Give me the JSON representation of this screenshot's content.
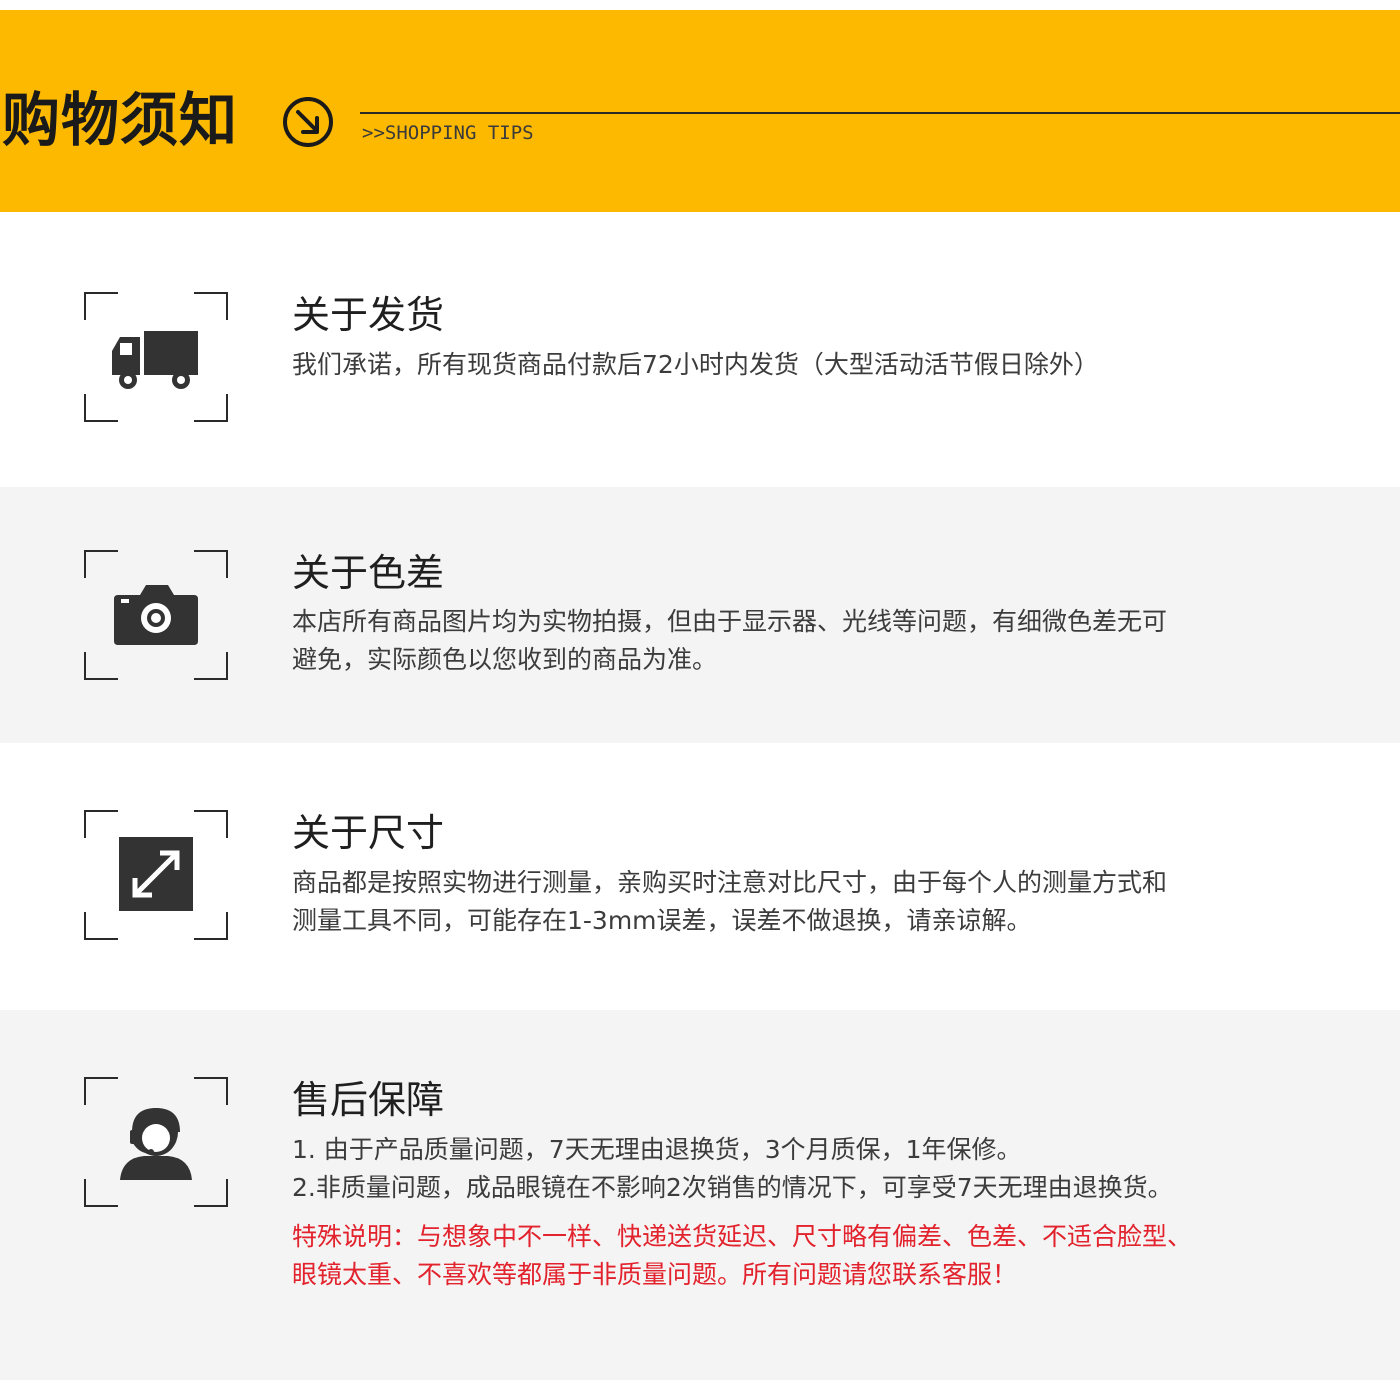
{
  "header": {
    "title": "购物须知",
    "subtitle": ">>SHOPPING TIPS",
    "background_color": "#fdb900",
    "arrow_icon": "circle-arrow-down-right-icon"
  },
  "sections": [
    {
      "icon": "truck-icon",
      "title": "关于发货",
      "lines": [
        "我们承诺，所有现货商品付款后72小时内发货（大型活动活节假日除外）"
      ]
    },
    {
      "icon": "camera-icon",
      "title": "关于色差",
      "lines": [
        "本店所有商品图片均为实物拍摄，但由于显示器、光线等问题，有细微色差无可",
        "避免，实际颜色以您收到的商品为准。"
      ]
    },
    {
      "icon": "resize-arrows-icon",
      "title": "关于尺寸",
      "lines": [
        "商品都是按照实物进行测量，亲购买时注意对比尺寸，由于每个人的测量方式和",
        "测量工具不同，可能存在1-3mm误差，误差不做退换，请亲谅解。"
      ]
    },
    {
      "icon": "customer-service-icon",
      "title": "售后保障",
      "lines": [
        "1. 由于产品质量问题，7天无理由退换货，3个月质保，1年保修。",
        "2.非质量问题，成品眼镜在不影响2次销售的情况下，可享受7天无理由退换货。"
      ],
      "special_lines": [
        "特殊说明：与想象中不一样、快递送货延迟、尺寸略有偏差、色差、不适合脸型、",
        "眼镜太重、不喜欢等都属于非质量问题。所有问题请您联系客服！"
      ],
      "special_color": "#e2222c"
    }
  ]
}
